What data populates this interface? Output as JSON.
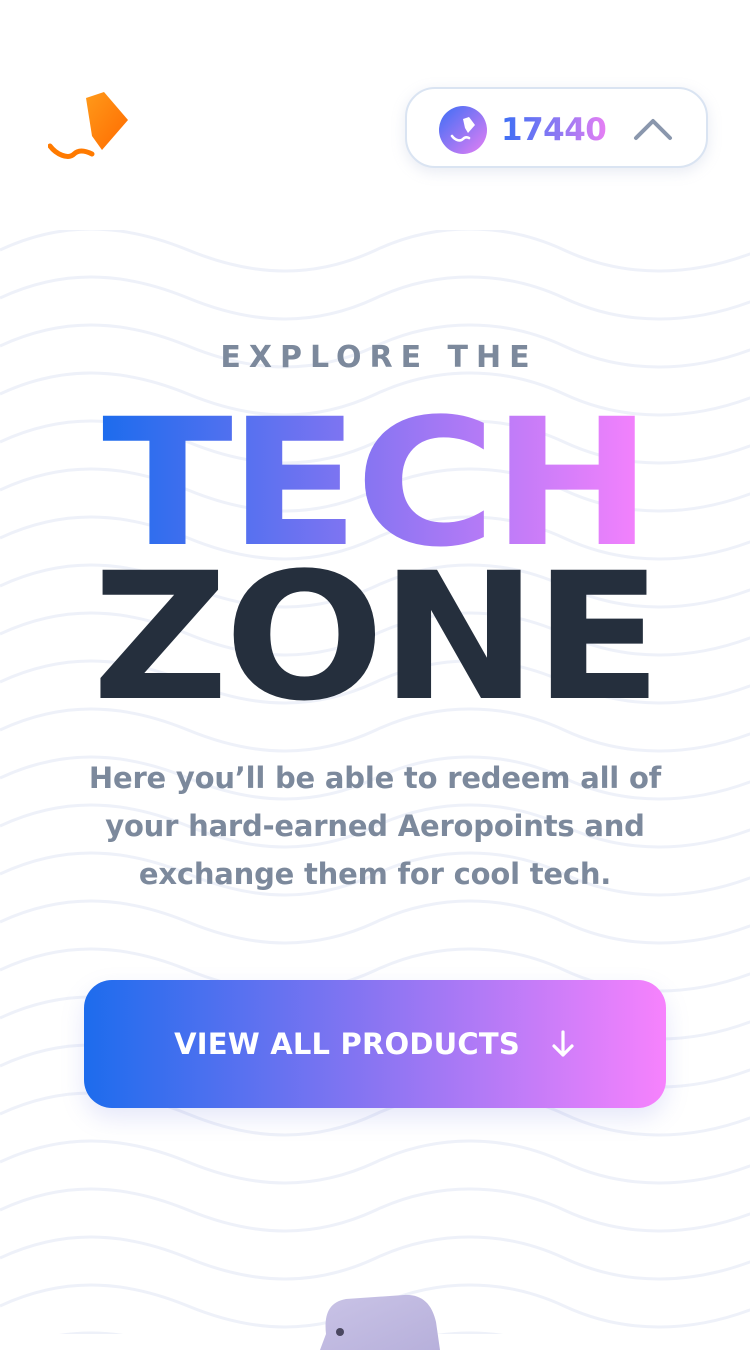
{
  "header": {
    "logo_icon": "aerolab-kite-logo-icon",
    "points": {
      "icon": "aeropoints-coin-icon",
      "value": "17440",
      "toggle_icon": "chevron-up-icon"
    }
  },
  "hero": {
    "eyebrow": "EXPLORE THE",
    "title_line1": "TECH",
    "title_line2": "ZONE",
    "description": "Here you’ll be able to redeem all of your hard-earned Aeropoints and exchange them for cool tech.",
    "cta_label": "VIEW ALL PRODUCTS",
    "cta_icon": "arrow-down-icon"
  },
  "colors": {
    "gradient_start": "#1d6ced",
    "gradient_mid": "#8a75f2",
    "gradient_end": "#f782fd",
    "heading_dark": "#252f3d",
    "text_muted": "#7c899c",
    "logo_orange": "#ff7a00"
  }
}
